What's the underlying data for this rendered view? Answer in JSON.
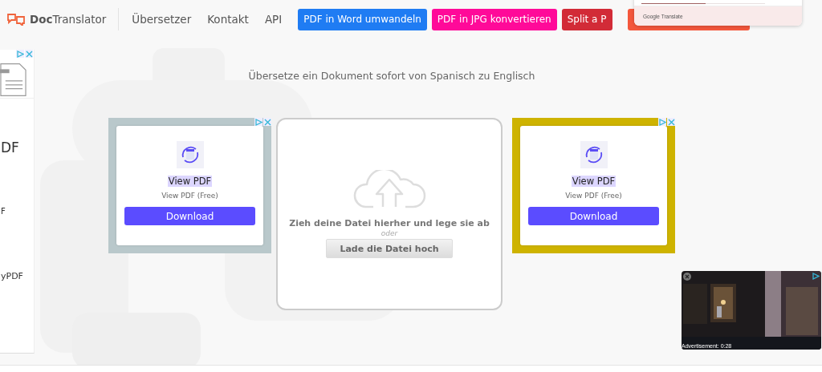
{
  "header": {
    "logo": "**Doc**Translator",
    "links": [
      "Übersetzer",
      "Kontakt",
      "API"
    ],
    "buttons": [
      {
        "label": "PDF in Word umwandeln",
        "color": "#1f7cf3"
      },
      {
        "label": "PDF in JPG konvertieren",
        "color": "#ff0a99"
      },
      {
        "label": "Split a P",
        "color": "#d22b37"
      },
      {
        "color": "#f4573c"
      }
    ]
  },
  "translate_popup": {
    "brand": "Google Translate",
    "level": 0.52
  },
  "sidebar_ad": {
    "texts": [
      "DF",
      "F",
      "yPDF"
    ]
  },
  "subtitle": "Übersetze ein Dokument sofort von Spanisch zu Englisch",
  "ads": [
    {
      "title": "View PDF",
      "subtitle": "View PDF (Free)",
      "button": "Download",
      "color": "#b9c8cb"
    },
    {
      "title": "View PDF",
      "subtitle": "View PDF (Free)",
      "button": "Download",
      "color": "#ceb300"
    }
  ],
  "dropzone": {
    "prompt": "Zieh deine Datei hierher und lege sie ab",
    "separator": "oder",
    "button": "Lade die Datei hoch"
  },
  "video_ad": {
    "caption": "Advertisement: 0:28"
  }
}
